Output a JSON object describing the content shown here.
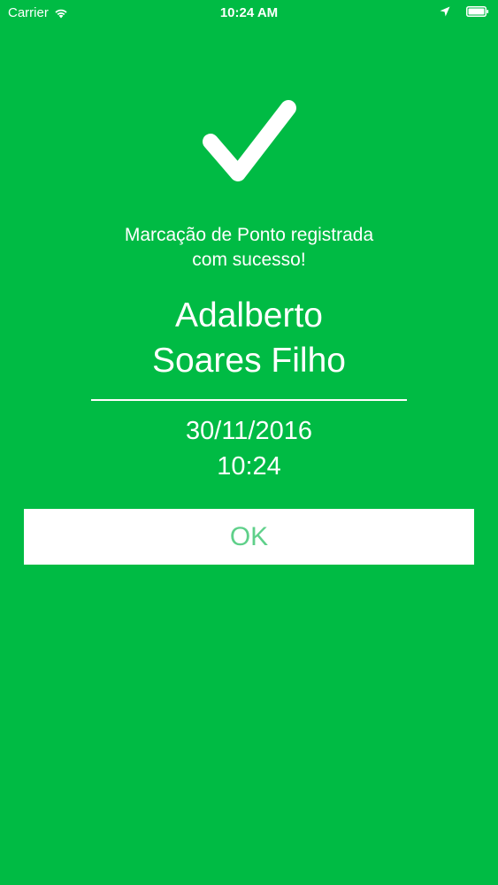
{
  "status_bar": {
    "carrier": "Carrier",
    "time": "10:24 AM",
    "icons": [
      "wifi-icon",
      "location-arrow-icon",
      "battery-icon"
    ]
  },
  "confirmation": {
    "icon": "checkmark-icon",
    "message_line1": "Marcação de Ponto registrada",
    "message_line2": "com sucesso!",
    "name_line1": "Adalberto",
    "name_line2": "Soares Filho",
    "date": "30/11/2016",
    "time": "10:24",
    "ok_label": "OK"
  },
  "colors": {
    "background": "#00bb44",
    "text": "#ffffff",
    "button_text": "#5fd08a"
  }
}
